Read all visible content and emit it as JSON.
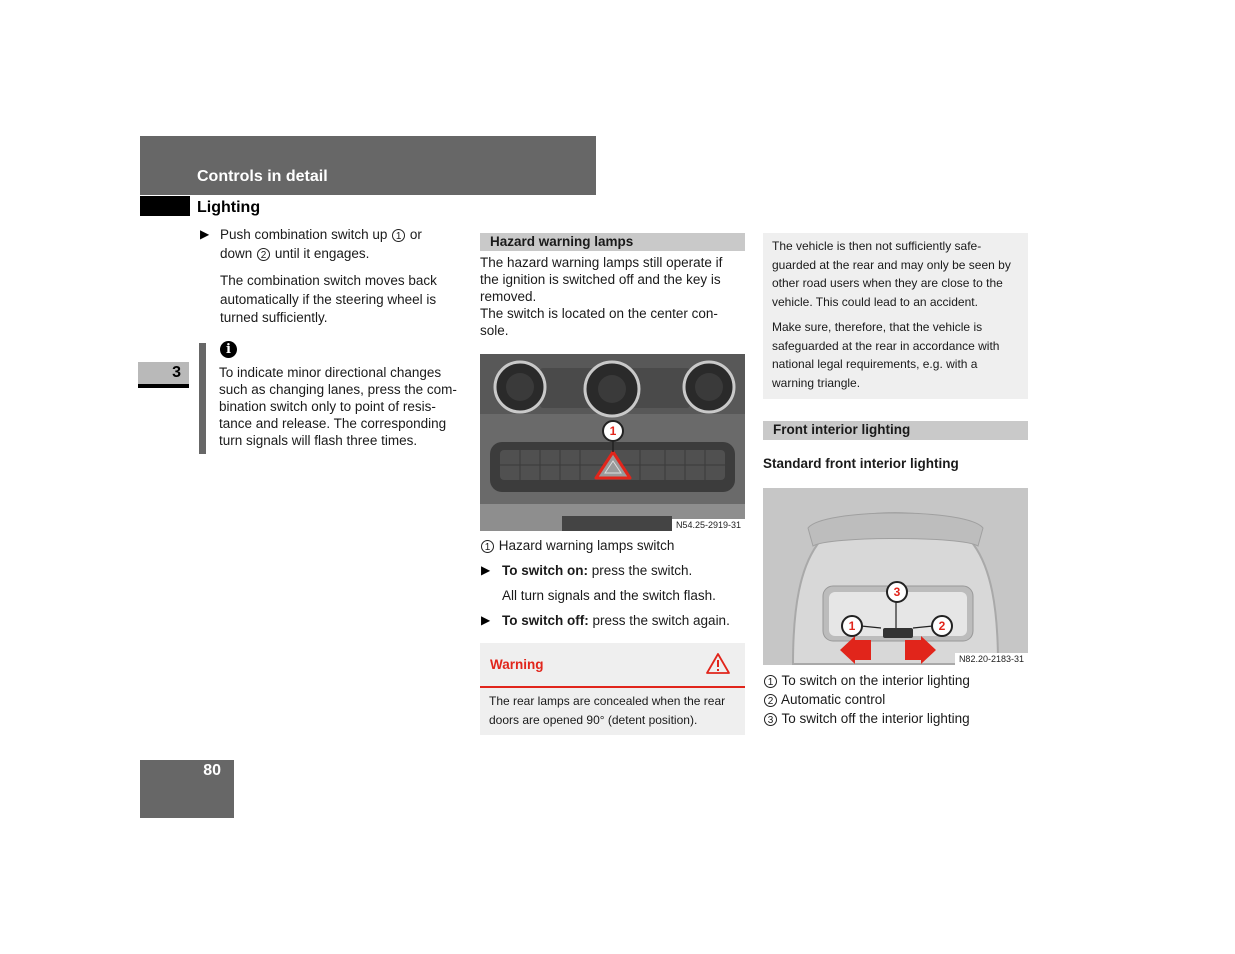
{
  "header": {
    "chapter_title": "Controls in detail",
    "section_title": "Lighting",
    "chapter_number": "3",
    "page_number": "80"
  },
  "left_column": {
    "step": {
      "text_before": "Push combination switch up",
      "callout_1": "1",
      "text_mid_1": "or",
      "text_line2_before": "down",
      "callout_2": "2",
      "text_after": "until it engages."
    },
    "note": [
      "The combination switch moves back",
      "automatically if the steering wheel is",
      "turned sufficiently."
    ],
    "info": {
      "icon": "info-icon",
      "glyph": "i",
      "lines": [
        "To indicate minor directional changes",
        "such as changing lanes, press the com-",
        "bination switch only to point of resis-",
        "tance and release. The corresponding",
        "turn signals will flash three times."
      ]
    }
  },
  "middle_column": {
    "heading": "Hazard warning lamps",
    "intro_lines": [
      "The hazard warning lamps still operate if",
      "the ignition is switched off and the key is",
      "removed.",
      "The switch is located on the center con-",
      "sole."
    ],
    "figure": {
      "code": "N54.25-2919-31",
      "callout": "1"
    },
    "legend": [
      {
        "num": "1",
        "text": "Hazard warning lamps switch"
      }
    ],
    "steps": [
      {
        "bold": "To switch on:",
        "text": " press the switch."
      },
      {
        "bold": "To switch off:",
        "text": " press the switch again."
      }
    ],
    "step_note": "All turn signals and the switch flash.",
    "warning": {
      "title": "Warning",
      "icon": "warning-triangle-icon",
      "lines": [
        "The rear lamps are concealed when the rear",
        "doors are opened 90° (detent position)."
      ],
      "accent_color": "#e1251b"
    }
  },
  "right_column": {
    "warning_continued": {
      "para1": [
        "The vehicle is then not sufficiently safe-",
        "guarded at the rear and may only be seen by",
        "other road users when they are close to the",
        "vehicle. This could lead to an accident."
      ],
      "para2": [
        "Make sure, therefore, that the vehicle is",
        "safeguarded at the rear in accordance with",
        "national legal requirements, e.g. with a",
        "warning triangle."
      ]
    },
    "heading": "Front interior lighting",
    "subheading": "Standard front interior lighting",
    "figure": {
      "code": "N82.20-2183-31",
      "callouts": [
        "1",
        "2",
        "3"
      ]
    },
    "legend": [
      {
        "num": "1",
        "text": "To switch on the interior lighting"
      },
      {
        "num": "2",
        "text": "Automatic control"
      },
      {
        "num": "3",
        "text": "To switch off the interior lighting"
      }
    ]
  }
}
